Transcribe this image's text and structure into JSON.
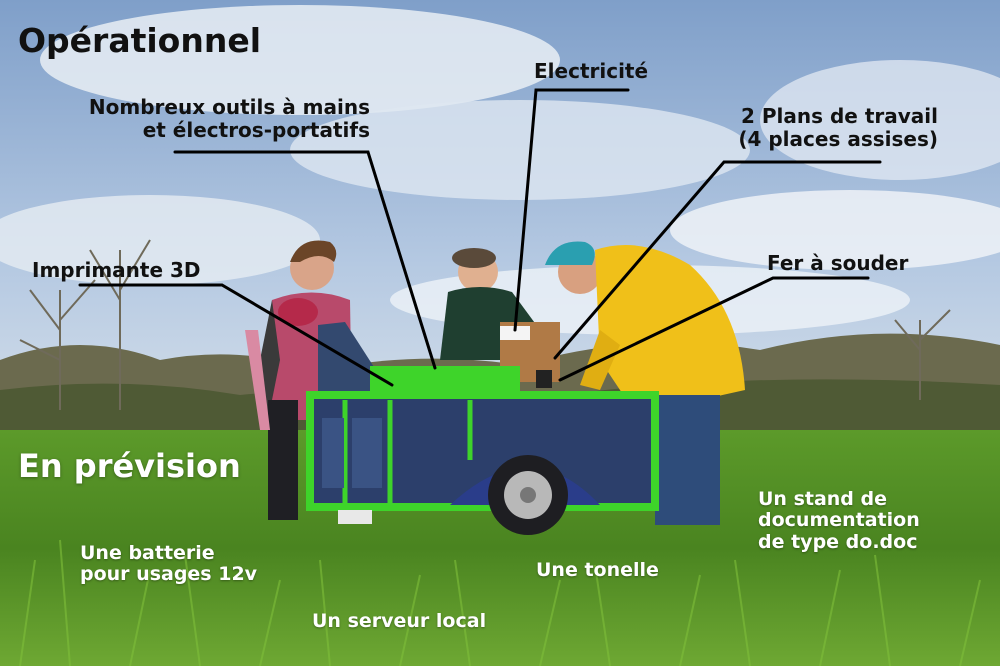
{
  "headings": {
    "operational": "Opérationnel",
    "planned": "En prévision"
  },
  "operational_labels": {
    "tools": [
      "Nombreux outils à mains",
      "et électros-portatifs"
    ],
    "electricity": "Electricité",
    "workbench": [
      "2 Plans de travail",
      "(4 places assises)"
    ],
    "printer": "Imprimante 3D",
    "soldering": "Fer à souder"
  },
  "planned_labels": {
    "battery": [
      "Une batterie",
      "pour usages 12v"
    ],
    "server": "Un serveur local",
    "arbor": "Une tonelle",
    "documentation": [
      "Un stand de",
      "documentation",
      "de type do.doc"
    ]
  },
  "colors": {
    "sky": "#a7bfdc",
    "cloud": "#eef2f7",
    "grass": "#4f8a1f",
    "cart_frame": "#3ed42a",
    "cart_panel": "#2c3f6b",
    "yellow_jacket": "#f2c21a",
    "beanie": "#2aa8b8",
    "leader_line": "#000000",
    "text_dark": "#111111",
    "text_light": "#ffffff"
  },
  "icons": []
}
